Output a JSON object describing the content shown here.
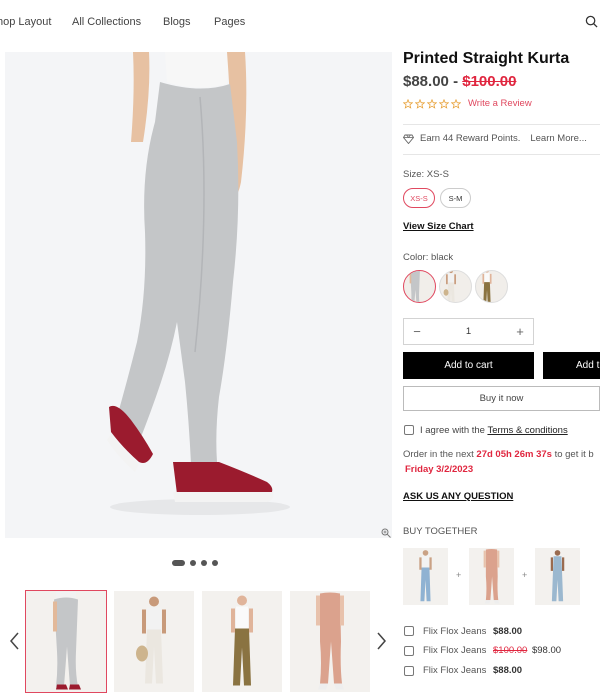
{
  "nav": {
    "items": [
      "hop Layout",
      "All Collections",
      "Blogs",
      "Pages"
    ]
  },
  "colors": {
    "accent": "#e0485f",
    "sale_red": "#e0263f",
    "button_black": "#000000",
    "pants_gray": "#c4c6c8",
    "shoe_red": "#9b1b2e"
  },
  "product": {
    "title": "Printed Straight Kurta",
    "price": "$88.00",
    "price_separator": "-",
    "compare_price": "$100.00",
    "rating": 0,
    "review_link": "Write a Review",
    "reward_text": "Earn 44 Reward Points.",
    "learn_more": "Learn More...",
    "size_label": "Size: XS-S",
    "sizes": [
      "XS-S",
      "S-M"
    ],
    "selected_size": "XS-S",
    "size_chart_link": "View Size Chart",
    "color_label": "Color: black",
    "quantity": "1",
    "add_to_cart": "Add to cart",
    "add_to_wishlist": "Add t",
    "buy_now": "Buy it now",
    "agree_text": "I agree with the",
    "terms_link": "Terms & conditions",
    "order_prefix": "Order in the next",
    "countdown": "27d 05h 26m 37s",
    "order_suffix": "to get it b",
    "delivery_date": "Friday 3/2/2023",
    "ask_question": "ASK US ANY QUESTION"
  },
  "buy_together": {
    "heading": "BUY TOGETHER",
    "items": [
      {
        "name": "Flix Flox Jeans",
        "price": "$88.00",
        "compare_price": "",
        "sale_price": ""
      },
      {
        "name": "Flix Flox Jeans",
        "price": "",
        "compare_price": "$100.00",
        "sale_price": "$98.00"
      },
      {
        "name": "Flix Flox Jeans",
        "price": "$88.00",
        "compare_price": "",
        "sale_price": ""
      }
    ]
  },
  "gallery": {
    "slide_count": 4,
    "active_slide": 1,
    "thumbnail_count": 4,
    "selected_thumbnail": 1
  }
}
